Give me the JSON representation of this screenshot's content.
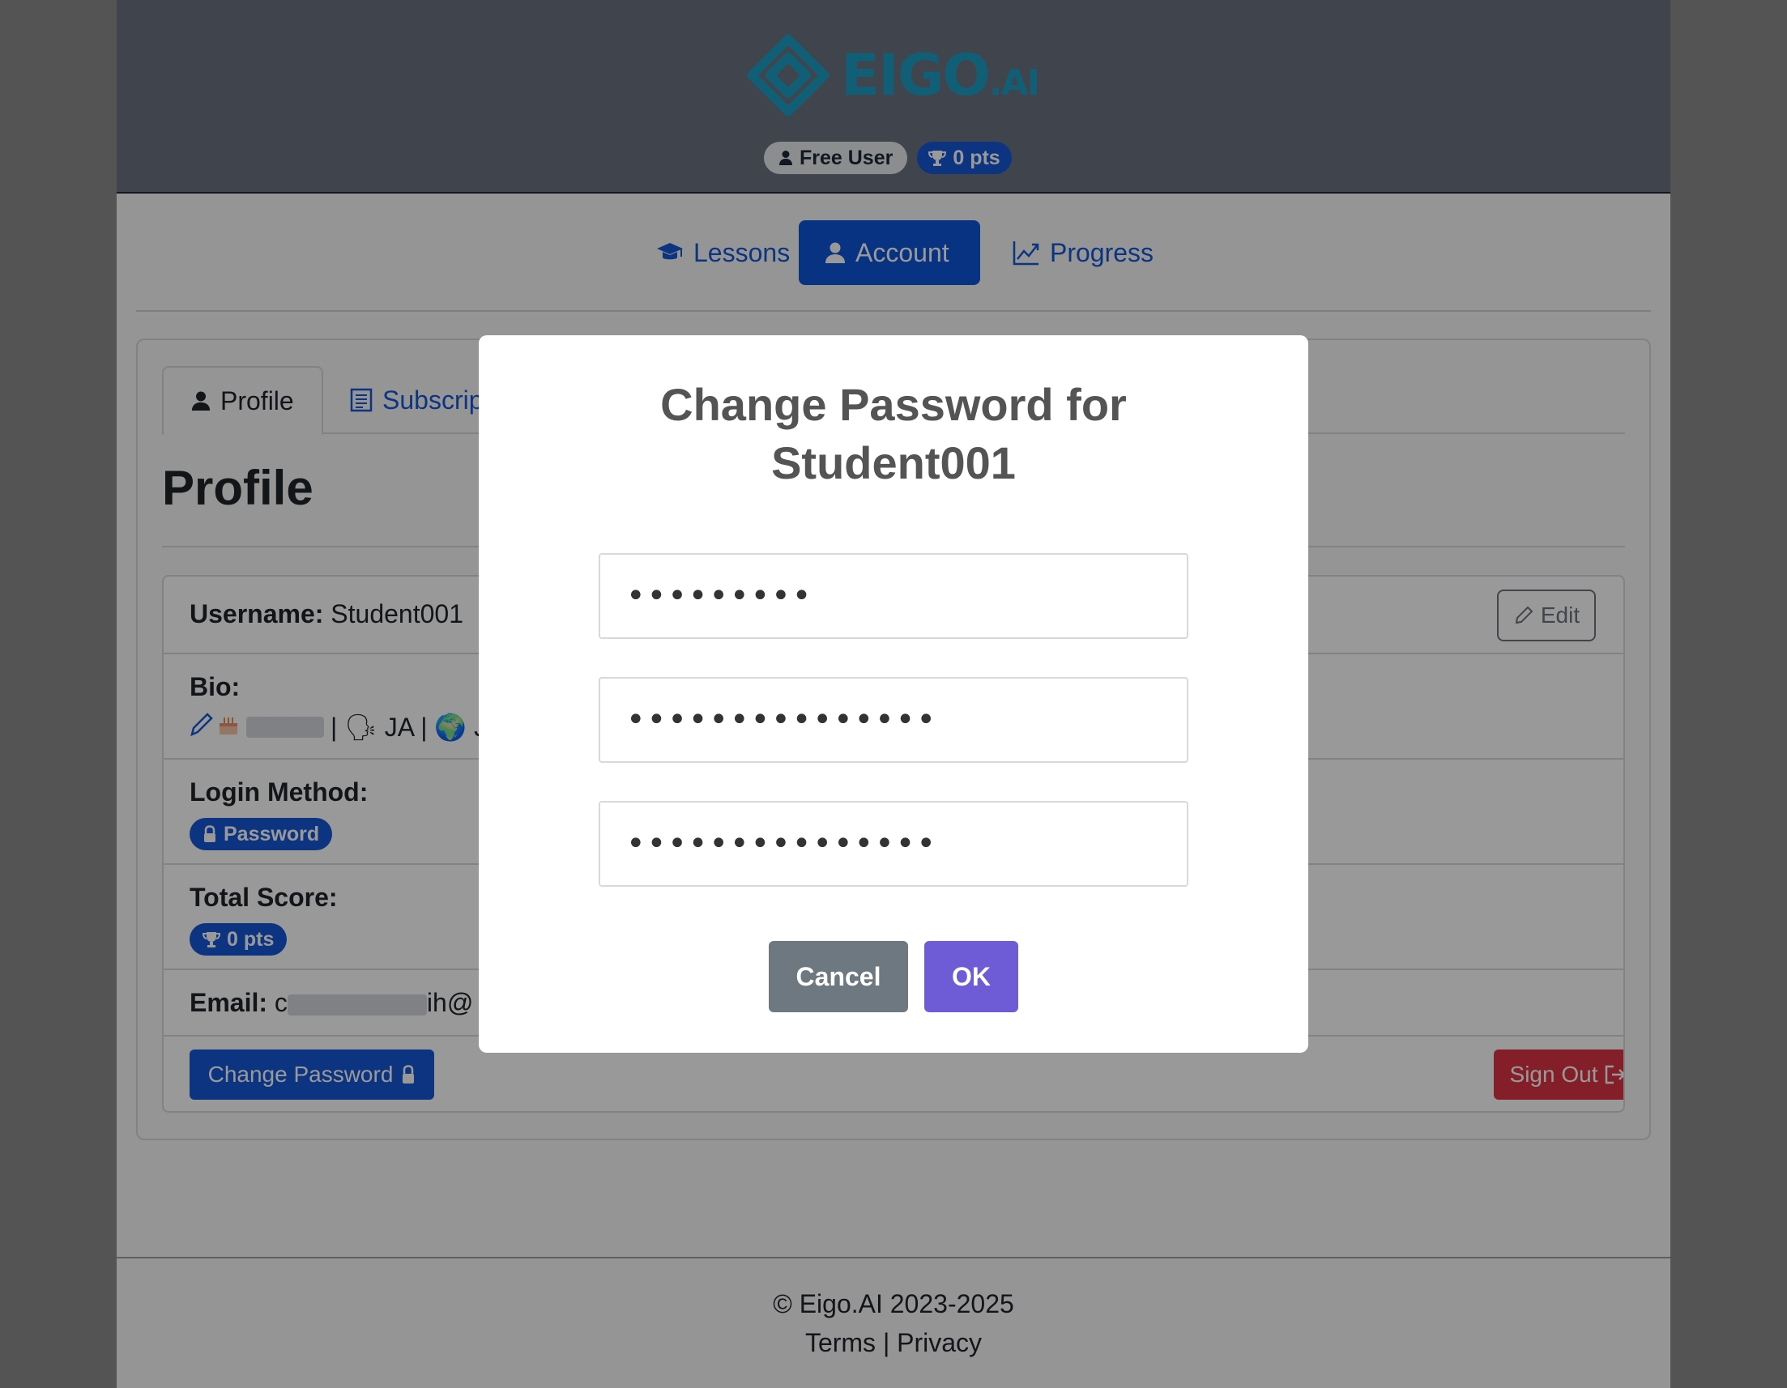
{
  "brand": {
    "logo_text": "EIGO",
    "logo_suffix": ".AI",
    "logo_color": "#1b9fc7"
  },
  "header": {
    "badges": {
      "user_label": "Free User",
      "user_icon": "user-icon",
      "points_label": "0 pts",
      "points_icon": "trophy-icon"
    }
  },
  "nav": {
    "items": [
      {
        "label": "Lessons",
        "icon": "graduation-cap-icon",
        "active": false
      },
      {
        "label": "Account",
        "icon": "user-icon",
        "active": true
      },
      {
        "label": "Progress",
        "icon": "chart-line-icon",
        "active": false
      }
    ]
  },
  "tabs": {
    "items": [
      {
        "label": "Profile",
        "icon": "user-icon",
        "active": true
      },
      {
        "label": "Subscription",
        "icon": "receipt-icon",
        "active": false
      }
    ]
  },
  "profile": {
    "title": "Profile",
    "username_label": "Username:",
    "username_value": "Student001",
    "edit_label": "Edit",
    "bio_label": "Bio:",
    "bio_lang": "| 🗣 JA | 🌍 Ja",
    "login_method_label": "Login Method:",
    "login_method_value": "Password",
    "total_score_label": "Total Score:",
    "total_score_value": "0 pts",
    "email_label": "Email:",
    "email_prefix": "c",
    "email_suffix": "ih@",
    "change_password_label": "Change Password",
    "sign_out_label": "Sign Out"
  },
  "footer": {
    "copyright": "© Eigo.AI 2023-2025",
    "terms": "Terms",
    "separator": "|",
    "privacy": "Privacy"
  },
  "modal": {
    "title_line1": "Change Password for",
    "title_line2": "Student001",
    "fields": [
      {
        "value": "•••••••••"
      },
      {
        "value": "•••••••••••••••"
      },
      {
        "value": "•••••••••••••••"
      }
    ],
    "cancel_label": "Cancel",
    "ok_label": "OK"
  },
  "colors": {
    "primary": "#1557d6",
    "danger": "#dc3545",
    "header_bg": "#6b7280",
    "ok_button": "#6e5bd6",
    "cancel_button": "#6e7881"
  }
}
